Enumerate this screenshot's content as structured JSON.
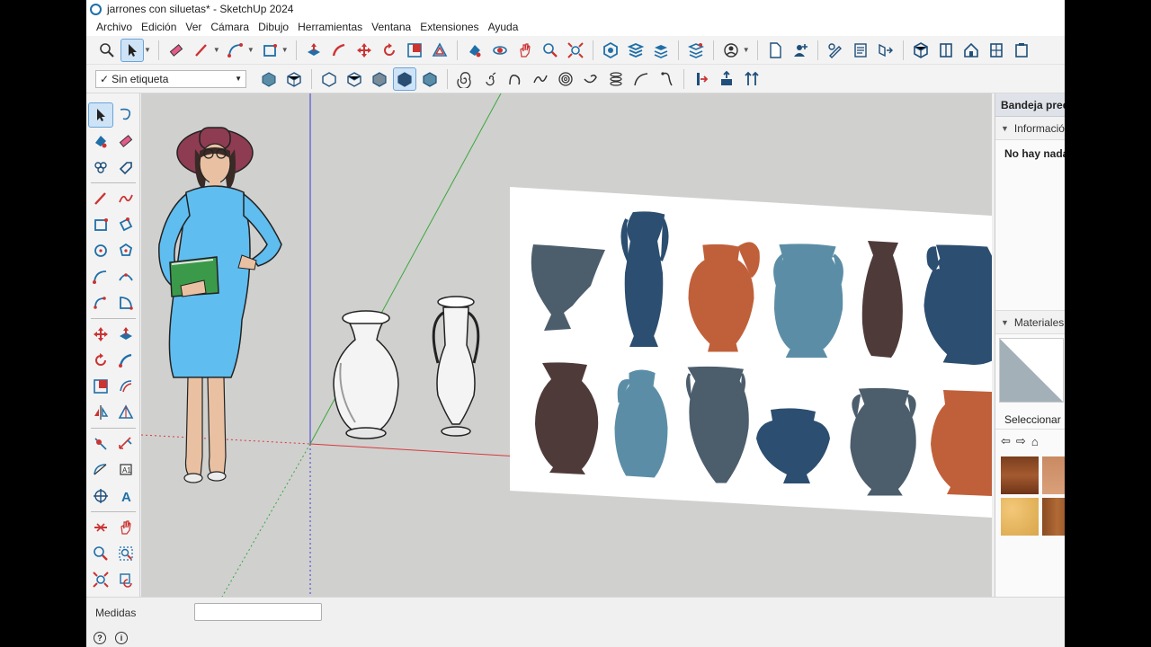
{
  "window": {
    "title": "jarrones con siluetas* - SketchUp 2024"
  },
  "menu": [
    "Archivo",
    "Edición",
    "Ver",
    "Cámara",
    "Dibujo",
    "Herramientas",
    "Ventana",
    "Extensiones",
    "Ayuda"
  ],
  "tag_selector": {
    "value": "Sin etiqueta"
  },
  "tray": {
    "title": "Bandeja predeterminada",
    "entity_info": {
      "title": "Información de la entidad",
      "empty_text": "No hay nada seleccionado"
    },
    "materials": {
      "title": "Materiales",
      "select_tab": "Seleccionar"
    }
  },
  "status": {
    "measure_label": "Medidas",
    "measure_value": ""
  },
  "colors": {
    "viewport_bg": "#d0d0cf",
    "axis_red": "#d83a3a",
    "axis_green": "#3aa83a",
    "axis_blue": "#3a3ad8",
    "vase_slate": "#4c5d6c",
    "vase_navy": "#2c4e70",
    "vase_orange": "#c0603a",
    "vase_teal": "#5b8ea6",
    "vase_brown": "#4f3a3a"
  },
  "icons": {
    "toolbar1": [
      "select-icon",
      "eraser-icon",
      "pencil-icon",
      "arc-icon",
      "rectangle-icon",
      "push-pull-icon",
      "follow-me-icon",
      "move-icon",
      "rotate-icon",
      "scale-icon",
      "offset-icon",
      "paint-icon",
      "orbit-icon",
      "pan-icon",
      "zoom-icon",
      "zoom-extents-icon",
      "warehouse-icon",
      "extension-warehouse-icon",
      "layout-icon",
      "account-icon",
      "new-file-icon",
      "add-user-icon",
      "tape-icon",
      "text-icon",
      "section-icon"
    ],
    "toolbar2": [
      "iso-view-icon",
      "top-view-icon",
      "front-view-icon",
      "right-view-icon",
      "back-view-icon",
      "left-view-icon",
      "spiral-icon",
      "helix-icon",
      "curve-icon"
    ]
  }
}
